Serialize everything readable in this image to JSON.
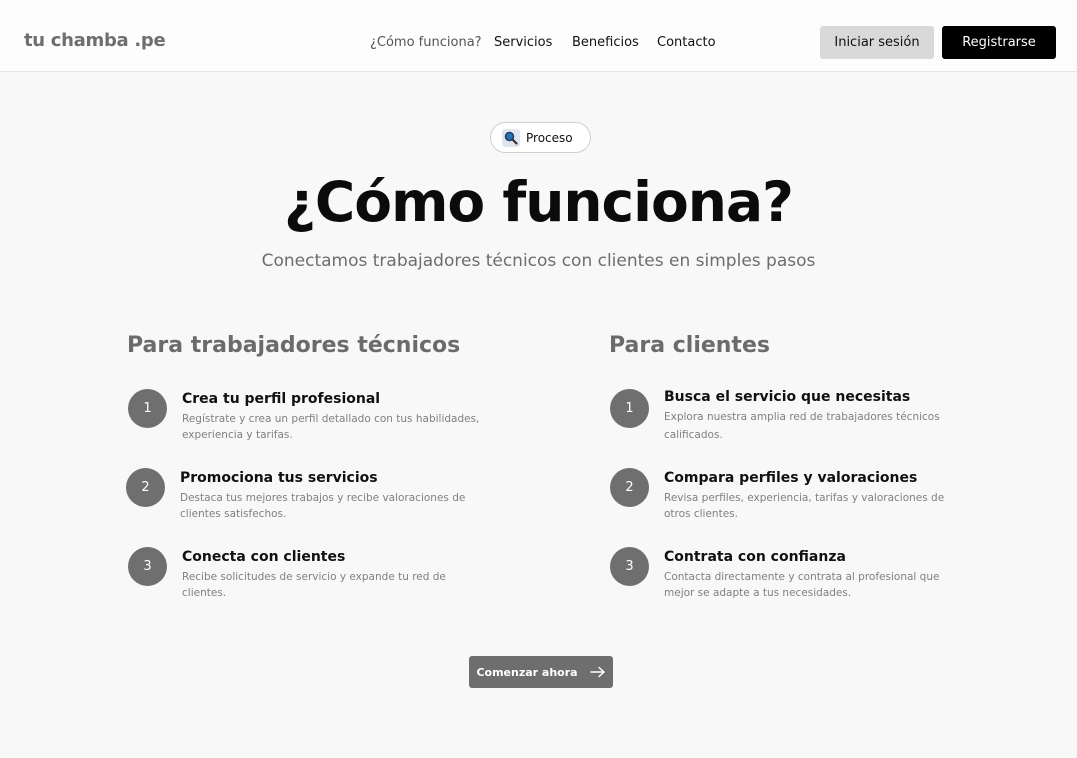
{
  "header": {
    "logo": "tu chamba .pe",
    "nav": [
      "¿Cómo funciona?",
      "Servicios",
      "Beneficios",
      "Contacto"
    ],
    "login_label": "Iniciar sesión",
    "register_label": "Registrarse"
  },
  "badge": {
    "label": "Proceso",
    "icon": "magnifier-icon"
  },
  "hero": {
    "title": "¿Cómo funciona?",
    "subtitle": "Conectamos trabajadores técnicos con clientes en simples pasos"
  },
  "workers": {
    "title": "Para trabajadores técnicos",
    "steps": [
      {
        "num": "1",
        "title": "Crea tu perfil profesional",
        "desc": "Regístrate y crea un perfil detallado con tus habilidades, experiencia y tarifas."
      },
      {
        "num": "2",
        "title": "Promociona tus servicios",
        "desc": "Destaca tus mejores trabajos y recibe valoraciones de clientes satisfechos."
      },
      {
        "num": "3",
        "title": "Conecta con clientes",
        "desc": "Recibe solicitudes de servicio y expande tu red de clientes."
      }
    ]
  },
  "clients": {
    "title": "Para clientes",
    "steps": [
      {
        "num": "1",
        "title": "Busca el servicio que necesitas",
        "desc": "Explora nuestra amplia red de trabajadores técnicos calificados."
      },
      {
        "num": "2",
        "title": "Compara perfiles y valoraciones",
        "desc": "Revisa perfiles, experiencia, tarifas y valoraciones de otros clientes."
      },
      {
        "num": "3",
        "title": "Contrata con confianza",
        "desc": "Contacta directamente y contrata al profesional que mejor se adapte a tus necesidades."
      }
    ]
  },
  "cta": {
    "label": "Comenzar ahora"
  }
}
